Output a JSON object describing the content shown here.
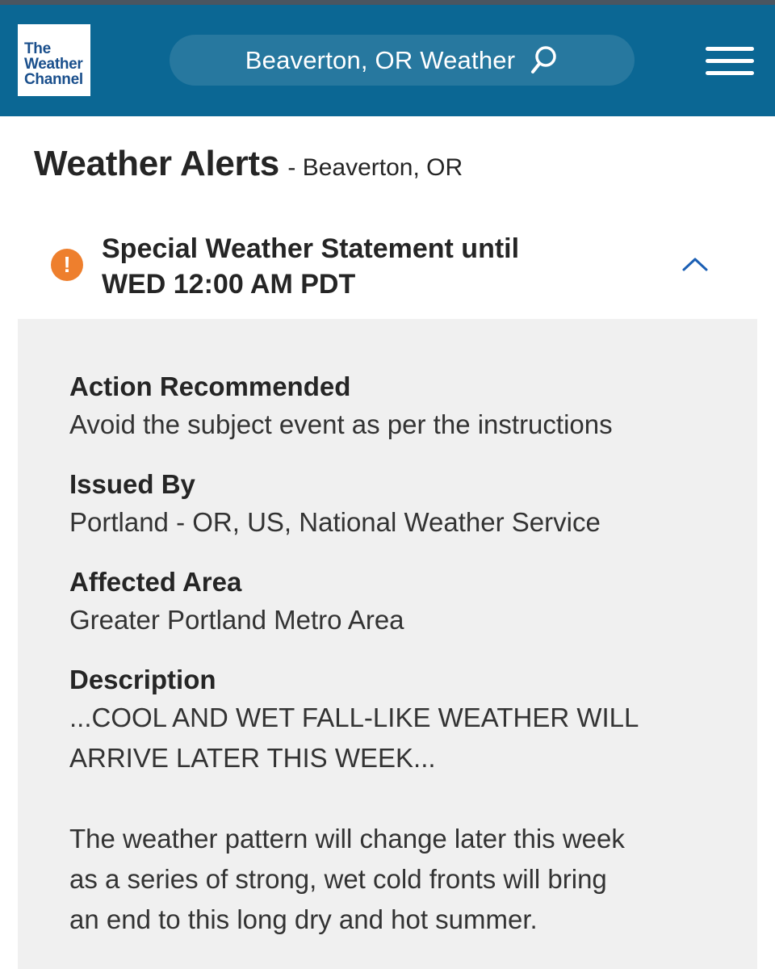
{
  "header": {
    "logo_lines": [
      "The",
      "Weather",
      "Channel"
    ],
    "search_text": "Beaverton, OR Weather",
    "search_icon": "search-icon",
    "menu_icon": "hamburger-menu-icon"
  },
  "page": {
    "title": "Weather Alerts",
    "subtitle": "- Beaverton, OR"
  },
  "alert": {
    "icon": "warning-icon",
    "icon_glyph": "!",
    "title_line1": "Special Weather Statement until",
    "title_line2": "WED 12:00 AM PDT",
    "expand_icon": "chevron-up-icon",
    "accent_color": "#ee7f2d"
  },
  "details": {
    "action": {
      "label": "Action Recommended",
      "value": "Avoid the subject event as per the instructions"
    },
    "issued_by": {
      "label": "Issued By",
      "value": "Portland - OR, US, National Weather Service"
    },
    "affected_area": {
      "label": "Affected Area",
      "value": "Greater Portland Metro Area"
    },
    "description": {
      "label": "Description",
      "lines": [
        "...COOL AND WET FALL-LIKE WEATHER WILL",
        "ARRIVE LATER THIS WEEK...",
        "",
        "The weather pattern will change later this week",
        "as a series of strong, wet cold fronts will bring",
        "an end to this long dry and hot summer."
      ]
    }
  },
  "colors": {
    "header_bg": "#0b6794",
    "search_bg": "#27789f",
    "details_bg": "#f0f0f0",
    "link_blue": "#1b5fb4"
  }
}
